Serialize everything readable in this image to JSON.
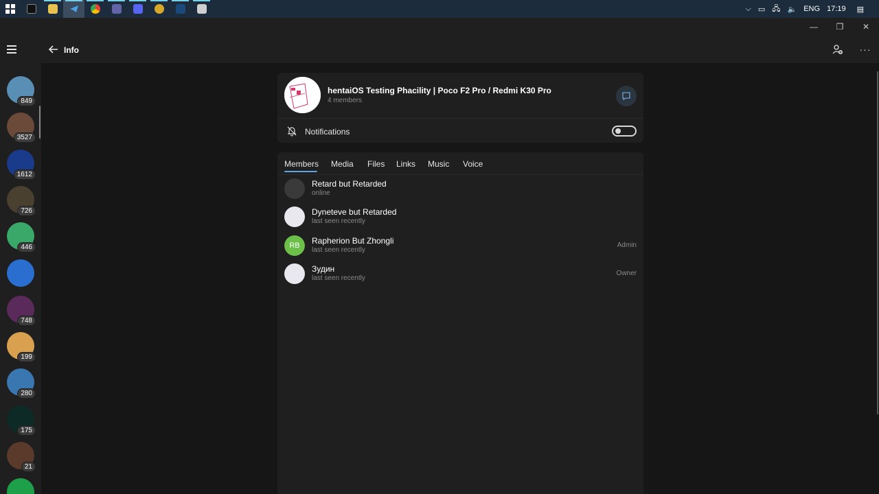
{
  "taskbar": {
    "clock": "17:19",
    "language": "ENG",
    "apps": [
      "terminal",
      "file-explorer",
      "telegram",
      "chrome",
      "teams",
      "discord",
      "app7",
      "steam",
      "app9"
    ]
  },
  "rail": {
    "chats": [
      {
        "badge": "849",
        "color": "#5a8fb5"
      },
      {
        "badge": "3527",
        "color": "#6b4a3a"
      },
      {
        "badge": "1612",
        "color": "#1a3a8a"
      },
      {
        "badge": "726",
        "color": "#4a4030"
      },
      {
        "badge": "446",
        "color": "#3aa868"
      },
      {
        "badge": "",
        "color": "#2a6fd0"
      },
      {
        "badge": "748",
        "color": "#5a2a5a"
      },
      {
        "badge": "199",
        "color": "#d9a050"
      },
      {
        "badge": "280",
        "color": "#3a77b0"
      },
      {
        "badge": "175",
        "color": "#0e2a26"
      },
      {
        "badge": "21",
        "color": "#5a3a2a"
      },
      {
        "badge": "",
        "color": "#1ea04a"
      }
    ]
  },
  "header": {
    "title": "Info"
  },
  "group": {
    "name": "hentaiOS Testing Phacility | Poco F2 Pro / Redmi K30 Pro",
    "members_count": "4 members",
    "notifications_label": "Notifications",
    "notifications_enabled": false
  },
  "tabs": [
    "Members",
    "Media",
    "Files",
    "Links",
    "Music",
    "Voice"
  ],
  "members": [
    {
      "name": "Retard but Retarded",
      "status": "online",
      "role": "",
      "initials": "",
      "avatar_color": "#3a3a3a"
    },
    {
      "name": "Dyneteve but Retarded",
      "status": "last seen recently",
      "role": "",
      "initials": "",
      "avatar_color": "#e8e8ee"
    },
    {
      "name": "Rapherion But Zhongli",
      "status": "last seen recently",
      "role": "Admin",
      "initials": "RB",
      "avatar_color": "#6cc04a"
    },
    {
      "name": "Зудин",
      "status": "last seen recently",
      "role": "Owner",
      "initials": "",
      "avatar_color": "#e8e8ee"
    }
  ]
}
